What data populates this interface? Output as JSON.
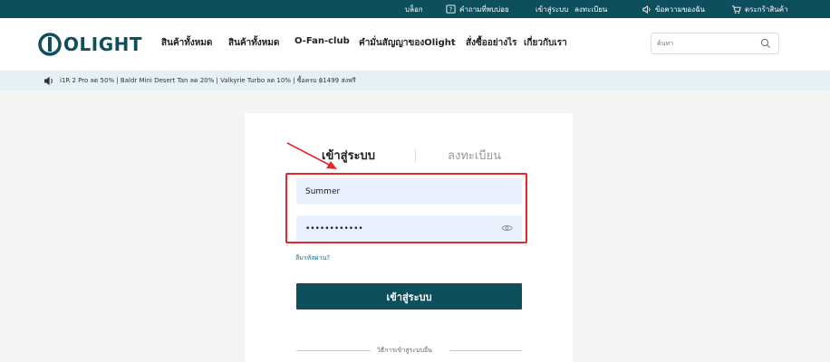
{
  "topbar": {
    "blog": "บล็อก",
    "faq": "คำถามที่พบบ่อย",
    "login": "เข้าสู่ระบบ",
    "register": "ลงทะเบียน",
    "messages": "ข้อความของฉัน",
    "cart": "ตระกร้าสินค้า"
  },
  "header": {
    "logo_text": "OLIGHT",
    "nav": [
      "สินค้าทั้งหมด",
      "สินค้าทั้งหมด",
      "O-Fan-club",
      "คำมั่นสัญญาของOlight",
      "สั่งซื้ออย่างไร",
      "เกี่ยวกับเรา"
    ],
    "search_placeholder": "ค้นหา"
  },
  "promo": {
    "text": "i1R 2 Pro ลด 50% | Baldr Mini Desert Tan ลด 20%  | Valkyrie Turbo ลด 10% | ซื้อครบ ฿1499 ส่งฟรี"
  },
  "login_card": {
    "tab_login": "เข้าสู่ระบบ",
    "tab_register": "ลงทะเบียน",
    "username_value": "Summer",
    "password_value": "••••••••••••",
    "forgot_password": "ลืมรหัสผ่าน?",
    "submit": "เข้าสู่ระบบ",
    "other_methods": "วิธีการเข้าสู่ระบบอื่น"
  },
  "colors": {
    "brand": "#0e4f5d",
    "promo_bg": "#e5f1f4",
    "field_bg": "#e9f0fd",
    "annotation_red": "#e5262b"
  }
}
